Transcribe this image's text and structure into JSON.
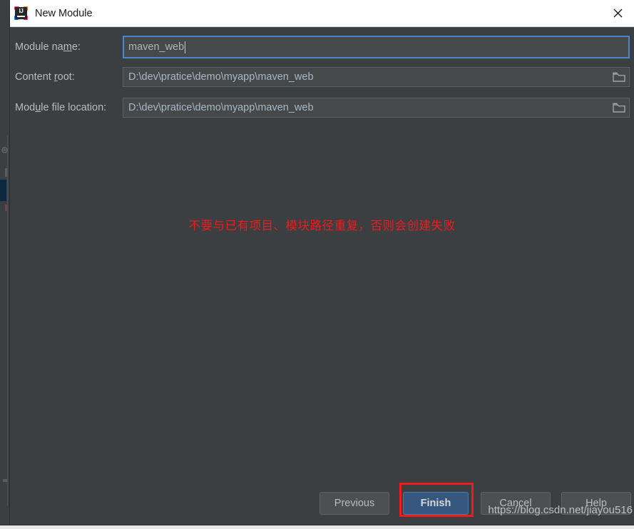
{
  "window": {
    "title": "New Module",
    "icon": "intellij-idea-icon",
    "icon_text": "IJ",
    "close_icon": "close-icon",
    "background_color": "#3c3f41",
    "titlebar_color": "#ffffff"
  },
  "form": {
    "fields": [
      {
        "label_before": "Module na",
        "label_mnemonic": "m",
        "label_after": "e:",
        "value": "maven_web",
        "focused": true,
        "has_browse": false,
        "name": "module-name"
      },
      {
        "label_before": "Content ",
        "label_mnemonic": "r",
        "label_after": "oot:",
        "value": "D:\\dev\\pratice\\demo\\myapp\\maven_web",
        "focused": false,
        "has_browse": true,
        "name": "content-root"
      },
      {
        "label_before": "Mod",
        "label_mnemonic": "u",
        "label_after": "le file location:",
        "value": "D:\\dev\\pratice\\demo\\myapp\\maven_web",
        "focused": false,
        "has_browse": true,
        "name": "module-file-location"
      }
    ]
  },
  "annotation": {
    "note_text": "不要与已有项目、模块路径重复，否则会创建失败",
    "note_color": "#f01a1a",
    "highlight_color": "#f01a1a",
    "highlight_target": "Finish"
  },
  "footer": {
    "buttons": [
      {
        "label": "Previous",
        "primary": false,
        "name": "previous-button"
      },
      {
        "label": "Finish",
        "primary": true,
        "name": "finish-button"
      },
      {
        "label": "Cancel",
        "primary": false,
        "name": "cancel-button"
      },
      {
        "label": "Help",
        "primary": false,
        "name": "help-button"
      }
    ],
    "primary_color": "#365880"
  },
  "watermark": {
    "text": "https://blog.csdn.net/jiayou516"
  }
}
